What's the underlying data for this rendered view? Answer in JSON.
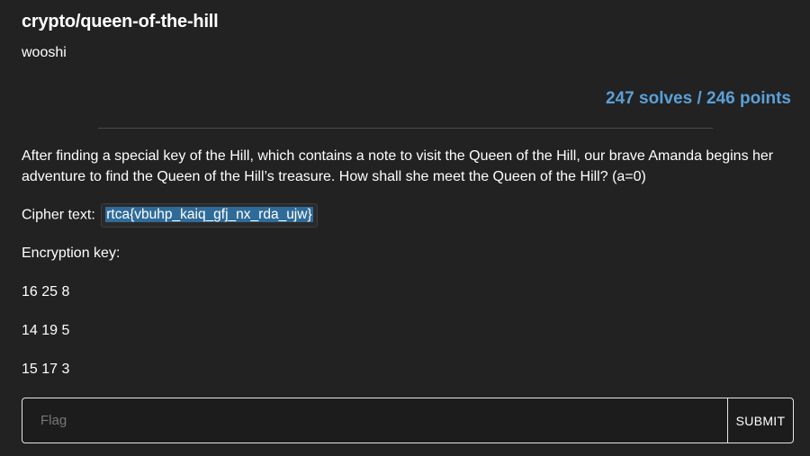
{
  "challenge": {
    "title": "crypto/queen-of-the-hill",
    "author": "wooshi",
    "stats": "247 solves / 246 points",
    "description": "After finding a special key of the Hill, which contains a note to visit the Queen of the Hill, our brave Amanda begins her adventure to find the Queen of the Hill’s treasure. How shall she meet the Queen of the Hill? (a=0)",
    "cipher_label": "Cipher text:",
    "cipher_text": "rtca{vbuhp_kaiq_gfj_nx_rda_ujw}",
    "key_label": "Encryption key:",
    "key_rows": [
      "16 25 8",
      "14 19 5",
      "15 17 3"
    ]
  },
  "form": {
    "flag_placeholder": "Flag",
    "flag_value": "",
    "submit_label": "SUBMIT"
  },
  "colors": {
    "background": "#222222",
    "stats_accent": "#5aa0d8",
    "selection": "#2f6b99"
  }
}
